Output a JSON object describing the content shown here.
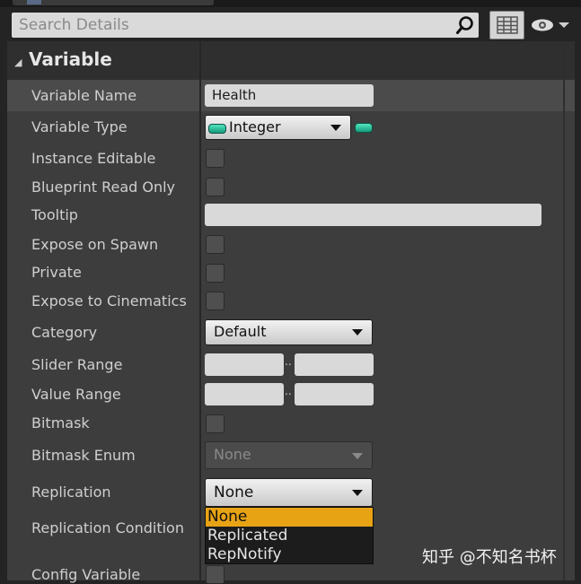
{
  "search": {
    "placeholder": "Search Details"
  },
  "category": {
    "title": "Variable"
  },
  "rows": {
    "variable_name": {
      "label": "Variable Name",
      "value": "Health"
    },
    "variable_type": {
      "label": "Variable Type",
      "value": "Integer",
      "pin_color": "#2fc49c"
    },
    "instance_editable": {
      "label": "Instance Editable",
      "checked": false
    },
    "blueprint_read_only": {
      "label": "Blueprint Read Only",
      "checked": false
    },
    "tooltip": {
      "label": "Tooltip",
      "value": ""
    },
    "expose_on_spawn": {
      "label": "Expose on Spawn",
      "checked": false
    },
    "private": {
      "label": "Private",
      "checked": false
    },
    "expose_to_cinematics": {
      "label": "Expose to Cinematics",
      "checked": false
    },
    "category": {
      "label": "Category",
      "value": "Default"
    },
    "slider_range": {
      "label": "Slider Range",
      "separator": ".."
    },
    "value_range": {
      "label": "Value Range",
      "separator": ".."
    },
    "bitmask": {
      "label": "Bitmask",
      "checked": false
    },
    "bitmask_enum": {
      "label": "Bitmask Enum",
      "value": "None"
    },
    "replication": {
      "label": "Replication",
      "value": "None"
    },
    "replication_condition": {
      "label": "Replication Condition"
    },
    "config_variable": {
      "label": "Config Variable"
    }
  },
  "replication_menu": {
    "options": [
      "None",
      "Replicated",
      "RepNotify"
    ],
    "highlighted": "None",
    "highlight_color": "#e8a315"
  },
  "watermark": "知乎 @不知名书杯"
}
